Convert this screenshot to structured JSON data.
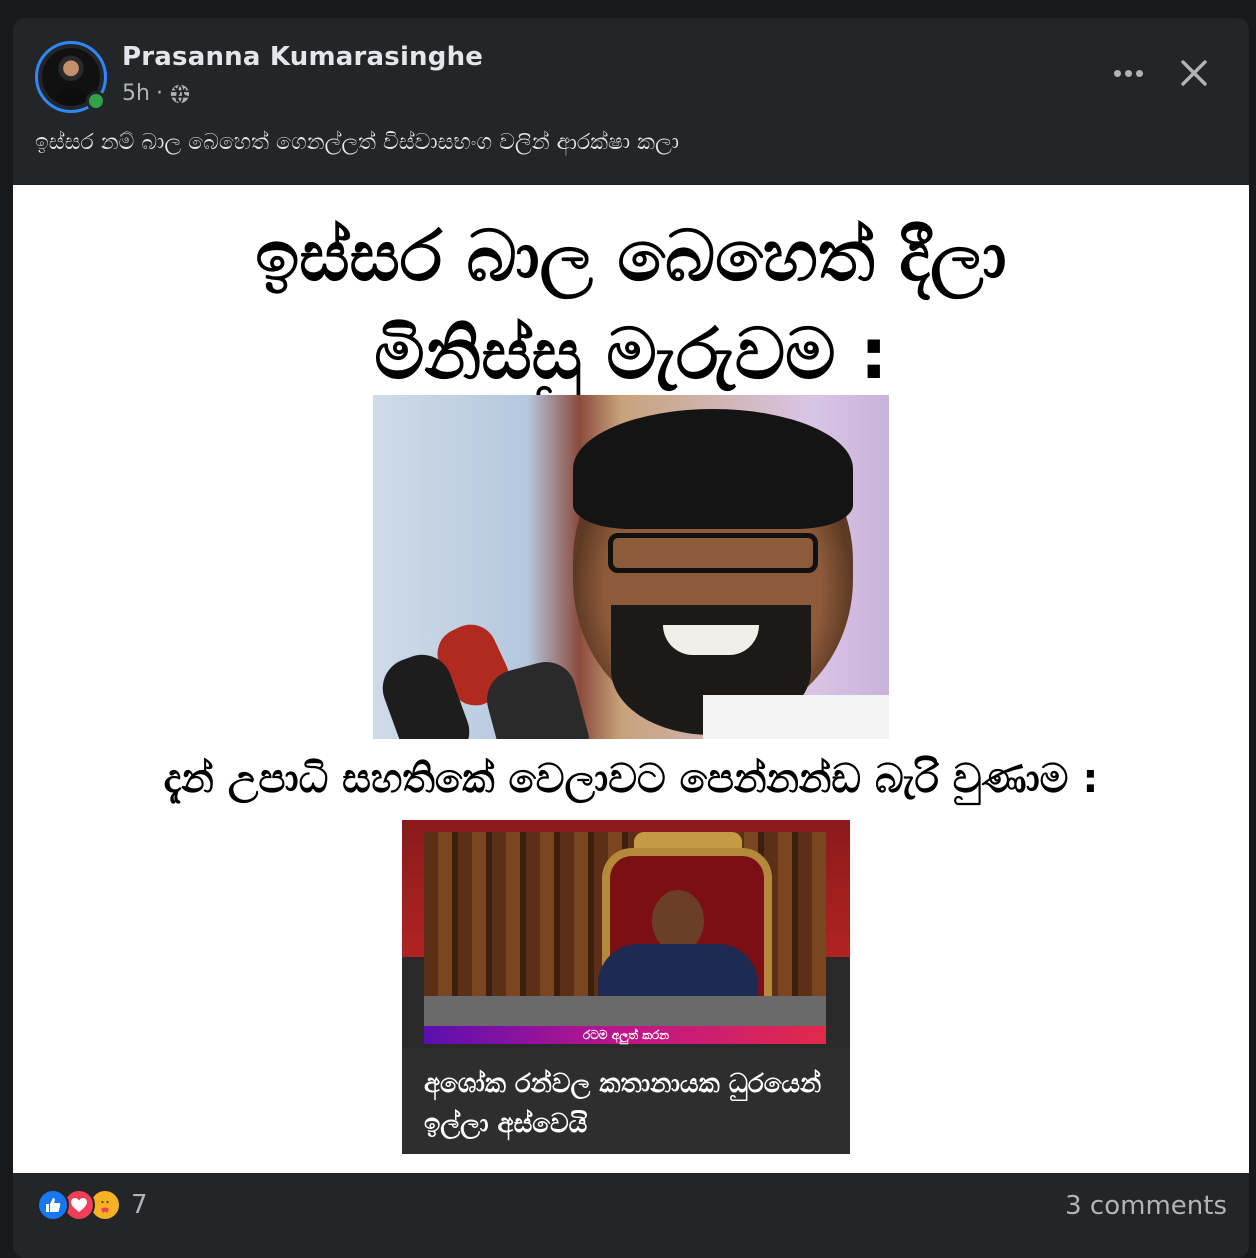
{
  "post": {
    "author": "Prasanna Kumarasinghe",
    "time": "5h",
    "separator": "·",
    "audience_icon": "globe-icon",
    "caption": "ඉස්සර නම් බාල බෙහෙත් ගෙනල්ලත් විස්වාසභංග වලින් ආරක්ෂා කලා"
  },
  "image": {
    "headline_line1": "ඉස්සර බාල බෙහෙත් දීලා",
    "headline_line2": "මිනිස්සු මැරුවම :",
    "subline": "දැන් උපාධි සහතිකේ වෙලාවට පෙන්නන්ඩ බැරි වුණාම :",
    "news_banner": "රටම අලුත් කරන",
    "news_title": "අශෝක රන්වල කතානායක ධුරයෙන් ඉල්ලා අස්වෙයි"
  },
  "footer": {
    "reaction_icons": [
      "like-icon",
      "love-icon",
      "care-icon"
    ],
    "reaction_count": "7",
    "comments": "3 comments"
  },
  "colors": {
    "background": "#18191a",
    "card": "#242526",
    "text_primary": "#e4e6eb",
    "text_secondary": "#b0b3b8",
    "online": "#31a24c",
    "accent": "#2d88ff"
  }
}
